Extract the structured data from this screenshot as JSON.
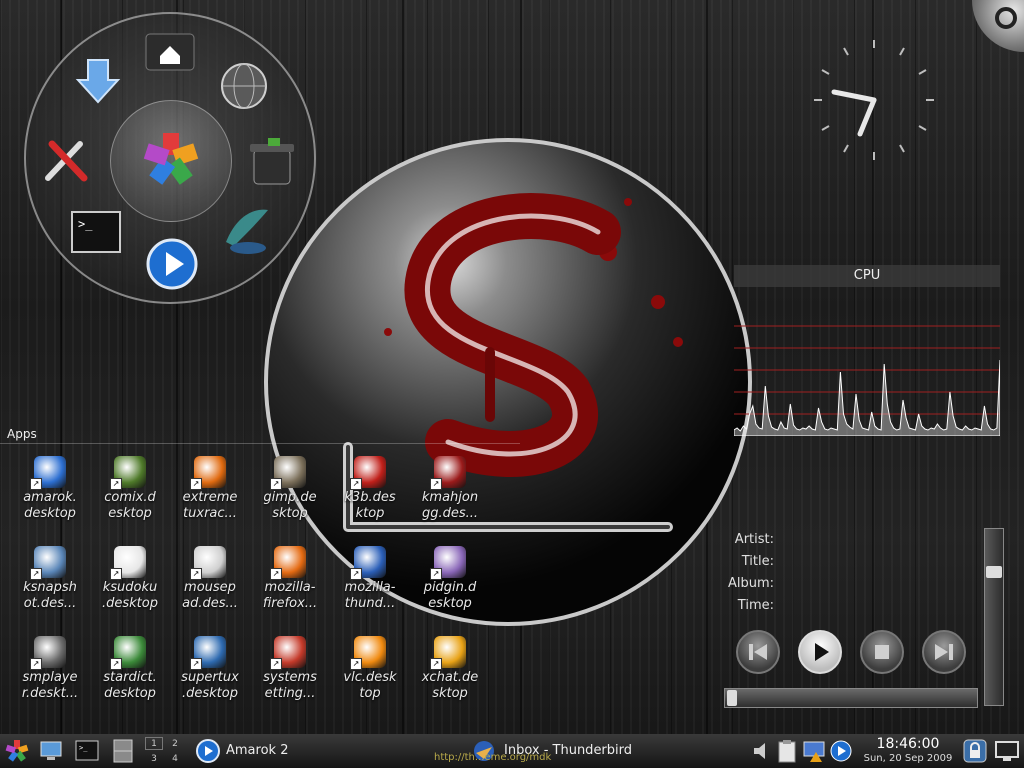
{
  "launcher": {
    "items": [
      "download-icon",
      "home-folder-icon",
      "globe-icon",
      "tools-icon",
      "trash-icon",
      "terminal-icon",
      "media-player-icon",
      "wing-icon"
    ],
    "center": "kde-menu-icon"
  },
  "cpu": {
    "title": "CPU",
    "samples": [
      4,
      6,
      3,
      8,
      5,
      20,
      28,
      10,
      6,
      5,
      48,
      18,
      7,
      5,
      4,
      12,
      6,
      5,
      30,
      9,
      5,
      4,
      6,
      5,
      8,
      5,
      4,
      26,
      12,
      5,
      4,
      6,
      5,
      4,
      62,
      20,
      10,
      7,
      5,
      40,
      14,
      6,
      5,
      4,
      22,
      8,
      5,
      4,
      70,
      30,
      12,
      6,
      4,
      5,
      34,
      16,
      6,
      5,
      4,
      20,
      8,
      5,
      4,
      6,
      5,
      10,
      6,
      4,
      5,
      42,
      18,
      7,
      5,
      4,
      8,
      5,
      4,
      6,
      5,
      4,
      28,
      10,
      5,
      4,
      6,
      74
    ],
    "line_color": "#ffffff",
    "grid_color": "#a02020"
  },
  "apps": {
    "title": "Apps",
    "items": [
      {
        "label": "amarok.\ndesktop",
        "color": "#2d6fd1"
      },
      {
        "label": "comix.d\nesktop",
        "color": "#4f7a2a"
      },
      {
        "label": "extreme\ntuxrac...",
        "color": "#e06a10"
      },
      {
        "label": "gimp.de\nsktop",
        "color": "#7b6f5a"
      },
      {
        "label": "k3b.des\nktop",
        "color": "#c0201a"
      },
      {
        "label": "kmahjon\ngg.des...",
        "color": "#9b1b1b"
      },
      {
        "label": "ksnapsh\not.des...",
        "color": "#5a86b8"
      },
      {
        "label": "ksudoku\n.desktop",
        "color": "#e6e6e6"
      },
      {
        "label": "mousep\nad.des...",
        "color": "#cfcfcf"
      },
      {
        "label": "mozilla-\nfirefox...",
        "color": "#e46a12"
      },
      {
        "label": "mozilla-\nthund...",
        "color": "#2b5fb8"
      },
      {
        "label": "pidgin.d\nesktop",
        "color": "#8a67b8"
      },
      {
        "label": "smplaye\nr.deskt...",
        "color": "#6a6a6a"
      },
      {
        "label": "stardict.\ndesktop",
        "color": "#3c8a3a"
      },
      {
        "label": "supertux\n.desktop",
        "color": "#2e6ab0"
      },
      {
        "label": "systems\netting...",
        "color": "#c43a2a"
      },
      {
        "label": "vlc.desk\ntop",
        "color": "#f08a10"
      },
      {
        "label": "xchat.de\nsktop",
        "color": "#e8a216"
      }
    ]
  },
  "player": {
    "artist_label": "Artist:",
    "title_label": "Title:",
    "album_label": "Album:",
    "time_label": "Time:",
    "seek_fraction": 0.0,
    "volume_fraction": 0.78
  },
  "taskbar": {
    "pager": [
      "1",
      "2",
      "3",
      "4"
    ],
    "tasks": [
      "Amarok 2",
      "Inbox - Thunderbird"
    ],
    "time": "18:46:00",
    "date": "Sun, 20 Sep 2009",
    "watermark": "http://th...eme.org/mdk"
  }
}
